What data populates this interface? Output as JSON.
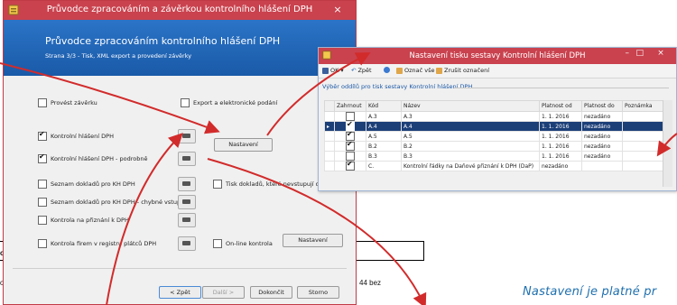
{
  "background_doc": {
    "fragment_1": "ov",
    "fragment_2": "od",
    "fragment_3": "44 bez",
    "annotation": "Nastavení je platné pr"
  },
  "wizard": {
    "title": "Průvodce zpracováním a závěrkou kontrolního hlášení DPH",
    "close_label": "×",
    "banner_title": "Průvodce zpracováním kontrolního hlášení DPH",
    "banner_subtitle": "Strana 3/3 - Tisk, XML export a provedení závěrky",
    "options": {
      "provest_zaverku": {
        "label": "Provést závěrku",
        "checked": false
      },
      "export": {
        "label": "Export a elektronické podání",
        "checked": false
      },
      "kontrolni_hlaseni": {
        "label": "Kontrolní hlášení DPH",
        "checked": true
      },
      "kontrolni_hlaseni_podrobne": {
        "label": "Kontrolní hlášení DPH - podrobně",
        "checked": true
      },
      "seznam_dokladu": {
        "label": "Seznam dokladů pro KH DPH",
        "checked": false
      },
      "tisk_dokladu": {
        "label": "Tisk dokladů, které nevstupují do K",
        "checked": false
      },
      "seznam_chybne": {
        "label": "Seznam dokladů pro KH DPH - chybné vstupy",
        "checked": false
      },
      "kontrola_priznani": {
        "label": "Kontrola na přiznání k DPH",
        "checked": false
      },
      "kontrola_firem": {
        "label": "Kontrola firem v registru plátců DPH",
        "checked": false
      },
      "online_kontrola": {
        "label": "On-line kontrola",
        "checked": false
      }
    },
    "nastaveni_label": "Nastavení",
    "nastaveni2_label": "Nastavení",
    "buttons": {
      "back": "< Zpět",
      "next": "Další >",
      "finish": "Dokončit",
      "cancel": "Storno"
    }
  },
  "settings": {
    "title": "Nastavení tisku sestavy Kontrolní hlášení DPH",
    "controls": {
      "minimize": "–",
      "maximize": "□",
      "close": "×"
    },
    "toolbar": {
      "ok": "OK",
      "back": "Zpět",
      "select_all": "Označ vše",
      "deselect": "Zrušit označení"
    },
    "group_title": "Výběr oddílů pro tisk sestavy Kontrolní hlášení DPH",
    "columns": [
      "Zahrnout",
      "Kód",
      "Název",
      "Platnost od",
      "Platnost do",
      "Poznámka"
    ],
    "rows": [
      {
        "include": false,
        "code": "A.3",
        "name": "A.3",
        "from": "1. 1. 2016",
        "to": "nezadáno",
        "note": "",
        "selected": false
      },
      {
        "include": true,
        "code": "A.4",
        "name": "A.4",
        "from": "1. 1. 2016",
        "to": "nezadáno",
        "note": "",
        "selected": true
      },
      {
        "include": true,
        "code": "A.5",
        "name": "A.5",
        "from": "1. 1. 2016",
        "to": "nezadáno",
        "note": "",
        "selected": false
      },
      {
        "include": true,
        "code": "B.2",
        "name": "B.2",
        "from": "1. 1. 2016",
        "to": "nezadáno",
        "note": "",
        "selected": false
      },
      {
        "include": false,
        "code": "B.3",
        "name": "B.3",
        "from": "1. 1. 2016",
        "to": "nezadáno",
        "note": "",
        "selected": false
      },
      {
        "include": true,
        "code": "C.",
        "name": "Kontrolní řádky na Daňové přiznání k DPH (DaP)",
        "from": "nezadáno",
        "to": "",
        "note": "",
        "selected": false
      }
    ]
  },
  "colors": {
    "titlebar": "#c9424e",
    "banner": "#2b74c7",
    "selection": "#1c3f78",
    "arrow": "#d22b2b",
    "annotation": "#1e6fae"
  }
}
